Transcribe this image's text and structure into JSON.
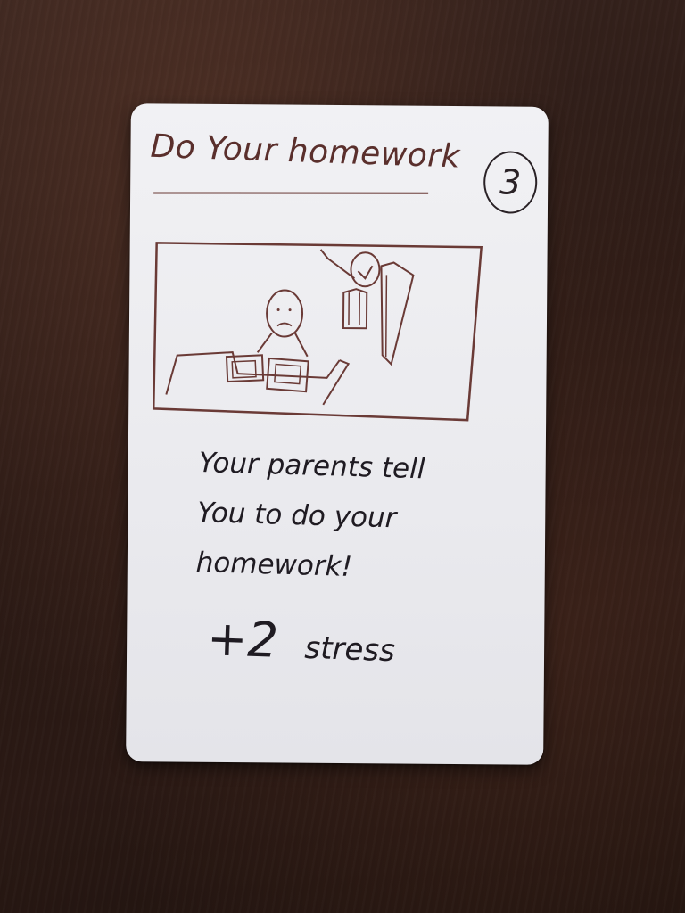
{
  "card": {
    "title": "Do Your homework",
    "cost": "3",
    "flavor_lines": [
      "Your parents tell",
      "You to do your",
      "homework!"
    ],
    "effect": {
      "amount": "+2",
      "stat": "stress"
    },
    "ink_color": "#5a2f2c",
    "text_color": "#1f1b22",
    "card_color": "#ededf0"
  },
  "illustration": {
    "subject": "student-at-desk-with-teacher-at-board-sketch"
  }
}
